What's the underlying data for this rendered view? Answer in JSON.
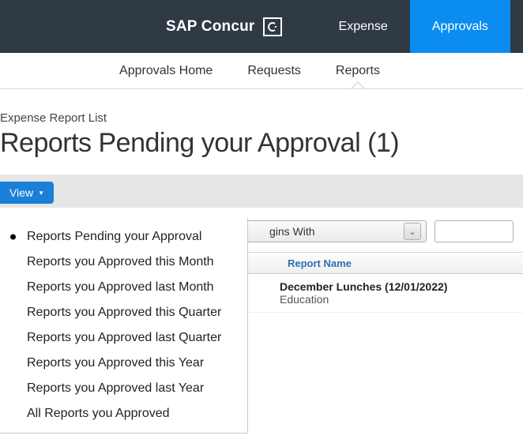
{
  "brand": {
    "text": "SAP Concur"
  },
  "topnav": {
    "items": [
      {
        "label": "Expense",
        "active": false
      },
      {
        "label": "Approvals",
        "active": true
      }
    ]
  },
  "subnav": {
    "items": [
      {
        "label": "Approvals Home"
      },
      {
        "label": "Requests"
      },
      {
        "label": "Reports",
        "active": true
      }
    ]
  },
  "breadcrumb": "Expense Report List",
  "title": "Reports Pending your Approval (1)",
  "view": {
    "button": "View",
    "options": [
      {
        "label": "Reports Pending your Approval",
        "selected": true
      },
      {
        "label": "Reports you Approved this Month"
      },
      {
        "label": "Reports you Approved last Month"
      },
      {
        "label": "Reports you Approved this Quarter"
      },
      {
        "label": "Reports you Approved last Quarter"
      },
      {
        "label": "Reports you Approved this Year"
      },
      {
        "label": "Reports you Approved last Year"
      },
      {
        "label": "All Reports you Approved"
      }
    ]
  },
  "filter": {
    "operator": "gins With",
    "search_value": ""
  },
  "table": {
    "columns": [
      "Report Name"
    ],
    "rows": [
      {
        "name": "December Lunches (12/01/2022)",
        "subtitle": "Education"
      }
    ]
  }
}
